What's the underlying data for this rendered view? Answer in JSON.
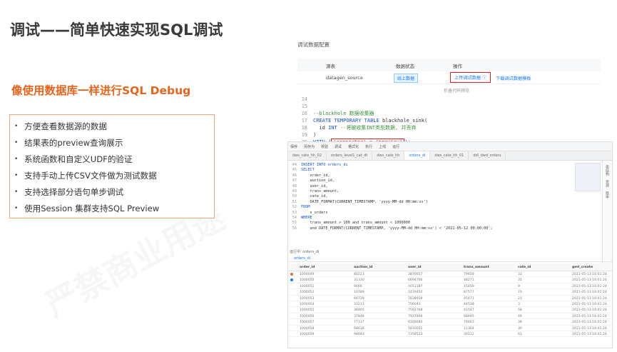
{
  "slide": {
    "title": "调试——简单快速实现SQL调试",
    "subtitle": "像使用数据库一样进行SQL Debug",
    "bullets": [
      "方便查看数据源的数据",
      "结果表的preview查询展示",
      "系统函数和自定义UDF的验证",
      "支持手动上传CSV文件做为测试数据",
      "支持选择部分语句单步调试",
      "使用Session 集群支持SQL Preview"
    ],
    "watermark": "严禁商业用途"
  },
  "config": {
    "title": "调试数据配置",
    "columns": [
      "源表",
      "数据状态",
      "操作"
    ],
    "row": {
      "source": "datagen_source",
      "status": "线上数据",
      "upload": "上传调试数据",
      "download": "下载调试数据模板"
    },
    "collapse": "折叠代码预览"
  },
  "code_top": [
    {
      "ln": "14",
      "html": ""
    },
    {
      "ln": "15",
      "html": ""
    },
    {
      "ln": "16",
      "parts": [
        [
          "cm",
          "--blackhole 数据收集器"
        ]
      ]
    },
    {
      "ln": "17",
      "parts": [
        [
          "kw",
          "CREATE TEMPORARY TABLE "
        ],
        [
          "",
          "blackhole_sink("
        ]
      ]
    },
    {
      "ln": "18",
      "parts": [
        [
          "",
          "  id "
        ],
        [
          "kw",
          "INT "
        ],
        [
          "cm",
          "--将被收集INT类型数据, 并丢弃"
        ]
      ]
    },
    {
      "ln": "19",
      "parts": [
        [
          "",
          ")"
        ]
      ]
    },
    {
      "ln": "20",
      "parts": [
        [
          "kw",
          "WITH "
        ],
        [
          "",
          "("
        ],
        [
          "box",
          "'connector' = 'preview'"
        ],
        [
          "",
          ");"
        ]
      ]
    }
  ],
  "ide": {
    "toolbar": [
      "保存",
      "另存为",
      "校验",
      "调试",
      "格式化",
      "执行",
      "上线",
      "运行"
    ],
    "tabs": [
      "dws_cate_hh_02",
      "orders_level1_cat_dt",
      "dws_cate_hh",
      "orders_di",
      "dws_cate_hh_01",
      "ddl_dwd_orders"
    ],
    "active_tab": "orders_di",
    "right_panel": [
      "表结构",
      "资源",
      "版本"
    ],
    "code": [
      {
        "ln": "44",
        "text": "INSERT INTO orders_di"
      },
      {
        "ln": "45",
        "text": "SELECT"
      },
      {
        "ln": "46",
        "text": "    order_id,"
      },
      {
        "ln": "47",
        "text": "    auction_id,"
      },
      {
        "ln": "48",
        "text": "    user_id,"
      },
      {
        "ln": "49",
        "text": "    trans_amount,"
      },
      {
        "ln": "50",
        "text": "    cate_id,"
      },
      {
        "ln": "51",
        "text": "    DATE_FORMAT(CURRENT_TIMESTAMP, 'yyyy-MM-dd HH:mm:ss')"
      },
      {
        "ln": "52",
        "text": "FROM"
      },
      {
        "ln": "53",
        "text": "    s_orders"
      },
      {
        "ln": "54",
        "text": "WHERE"
      },
      {
        "ln": "55",
        "text": "    trans_amount > 100 and trans_amount < 1000000"
      },
      {
        "ln": "56",
        "text": "    and DATE_FORMAT(CURRENT_TIMESTAMP, 'yyyy-MM-dd HH:mm:ss') < '2021-05-12 00:00:00';"
      }
    ],
    "result_label": "运行中: orders_di",
    "result_tab": "orders_di",
    "columns": [
      "order_id",
      "auction_id",
      "user_id",
      "trans_amount",
      "cate_id",
      "gmt_create"
    ],
    "rows": [
      [
        "1000049",
        "80223",
        "3876657",
        "79658",
        "33",
        "2021-05-13 16:01:24"
      ],
      [
        "1000050",
        "31330",
        "6694700",
        "48271",
        "31",
        "2021-05-13 16:01:24"
      ],
      [
        "1000051",
        "9066",
        "1651187",
        "15459",
        "9",
        "2021-05-13 16:01:24"
      ],
      [
        "1000052",
        "10789",
        "1419450",
        "87577",
        "70",
        "2021-05-13 16:01:24"
      ],
      [
        "1000053",
        "66739",
        "7838939",
        "45471",
        "21",
        "2021-05-13 16:01:24"
      ],
      [
        "1000054",
        "33233",
        "756043",
        "44538",
        "3",
        "2021-05-13 16:01:24"
      ],
      [
        "1000055",
        "36805",
        "7582768",
        "41547",
        "58",
        "2021-05-13 16:01:24"
      ],
      [
        "1000056",
        "37848",
        "7937806",
        "68695",
        "49",
        "2021-05-13 16:01:24"
      ],
      [
        "1000057",
        "77137",
        "6169080",
        "74603",
        "38",
        "2021-05-13 16:01:24"
      ],
      [
        "1000058",
        "68618",
        "5810031",
        "11364",
        "30",
        "2021-05-13 16:01:24"
      ],
      [
        "1000059",
        "98693",
        "7358523",
        "30112",
        "61",
        "2021-05-13 16:01:24"
      ]
    ],
    "row_markers": [
      {
        "row": 0,
        "color": "#e0703a"
      },
      {
        "row": 1,
        "color": "#1677ff"
      }
    ]
  }
}
